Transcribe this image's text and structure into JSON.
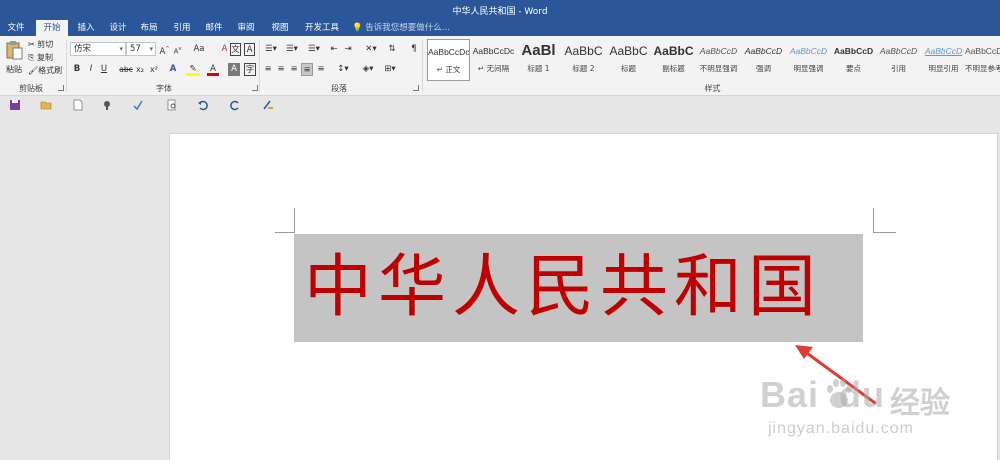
{
  "window": {
    "title": "中华人民共和国 - Word"
  },
  "tabs": [
    {
      "label": "文件"
    },
    {
      "label": "开始"
    },
    {
      "label": "插入"
    },
    {
      "label": "设计"
    },
    {
      "label": "布局"
    },
    {
      "label": "引用"
    },
    {
      "label": "邮件"
    },
    {
      "label": "审阅"
    },
    {
      "label": "视图"
    },
    {
      "label": "开发工具"
    }
  ],
  "active_tab": "开始",
  "tell_me": {
    "placeholder": "告诉我您想要做什么..."
  },
  "clipboard": {
    "paste": "粘贴",
    "cut": "剪切",
    "copy": "复制",
    "format_painter": "格式刷",
    "group": "剪贴板"
  },
  "font": {
    "name": "仿宋",
    "size": "57",
    "group": "字体",
    "bold": "B",
    "italic": "I",
    "underline": "U",
    "strike": "abc",
    "sub": "x₂",
    "sup": "x²",
    "aa": "Aa",
    "clear": "A",
    "phonetic": "文",
    "border": "A",
    "grow": "A",
    "shrink": "A",
    "fontcolor": "A",
    "shade": "A"
  },
  "paragraph": {
    "group": "段落"
  },
  "styles": {
    "group": "样式",
    "items": [
      {
        "preview": "AaBbCcDc",
        "label": "↵ 正文",
        "selected": true
      },
      {
        "preview": "AaBbCcDc",
        "label": "↵ 无间隔"
      },
      {
        "preview": "AaBl",
        "label": "标题 1"
      },
      {
        "preview": "AaBbC",
        "label": "标题 2"
      },
      {
        "preview": "AaBbC",
        "label": "标题"
      },
      {
        "preview": "AaBbC",
        "label": "副标题"
      },
      {
        "preview": "AaBbCcD",
        "label": "不明显强调"
      },
      {
        "preview": "AaBbCcD",
        "label": "强调"
      },
      {
        "preview": "AaBbCcD",
        "label": "明显强调"
      },
      {
        "preview": "AaBbCcD",
        "label": "要点"
      },
      {
        "preview": "AaBbCcD",
        "label": "引用"
      },
      {
        "preview": "AaBbCcD",
        "label": "明显引用"
      },
      {
        "preview": "AaBbCcDc",
        "label": "不明显参考"
      }
    ]
  },
  "document": {
    "text": "中华人民共和国",
    "text_color": "#c00000",
    "highlight_color": "#c4c4c4"
  },
  "watermark": {
    "brand": "Bai",
    "brand2": "du",
    "suffix": "经验",
    "url": "jingyan.baidu.com"
  },
  "colors": {
    "accent": "#2b579a",
    "arrow": "#e03c31"
  }
}
